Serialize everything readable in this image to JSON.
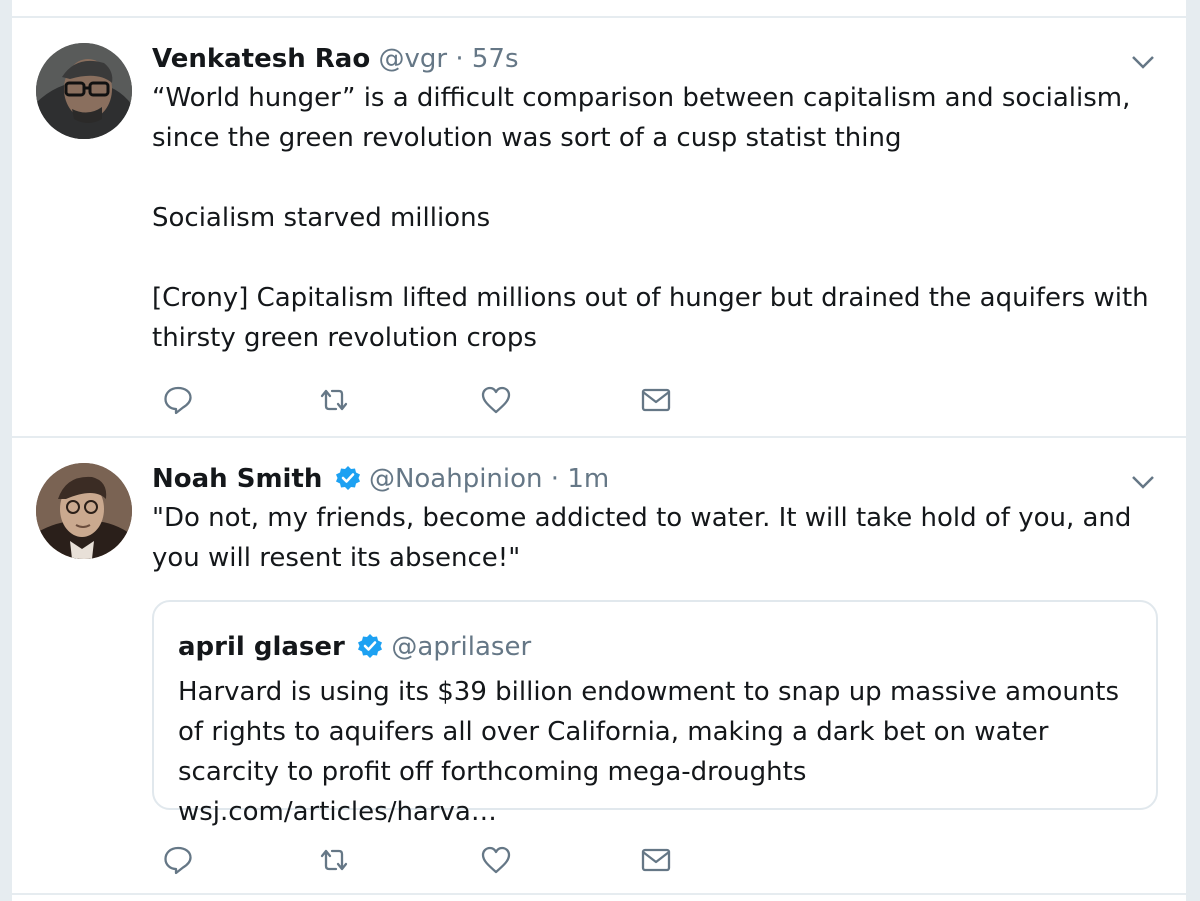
{
  "tweets": [
    {
      "author_name": "Venkatesh Rao",
      "handle": "@vgr",
      "separator": "·",
      "time": "57s",
      "verified": false,
      "paragraphs": [
        "“World hunger” is a difficult comparison between capitalism and socialism, since the green revolution was sort of a cusp statist thing",
        "Socialism starved millions",
        "[Crony] Capitalism lifted millions out of hunger but drained the aquifers with thirsty green revolution crops"
      ]
    },
    {
      "author_name": "Noah Smith",
      "handle": "@Noahpinion",
      "separator": "·",
      "time": "1m",
      "verified": true,
      "paragraphs": [
        "\"Do not, my friends, become addicted to water. It will take hold of you, and you will resent its absence!\""
      ],
      "quoted": {
        "author_name": "april glaser",
        "handle": "@aprilaser",
        "verified": true,
        "text": "Harvard is using its $39 billion endowment to snap up massive amounts of rights to aquifers all over California, making a dark bet on water scarcity to profit off forthcoming mega-droughts wsj.com/articles/harva…"
      }
    }
  ],
  "icons": {
    "reply": "reply-icon",
    "retweet": "retweet-icon",
    "like": "heart-icon",
    "dm": "envelope-icon",
    "more": "chevron-down-icon",
    "verified": "verified-badge-icon"
  },
  "colors": {
    "background": "#e6ecf0",
    "card": "#ffffff",
    "text": "#14171a",
    "secondary_text": "#657786",
    "verified": "#1da1f2"
  }
}
